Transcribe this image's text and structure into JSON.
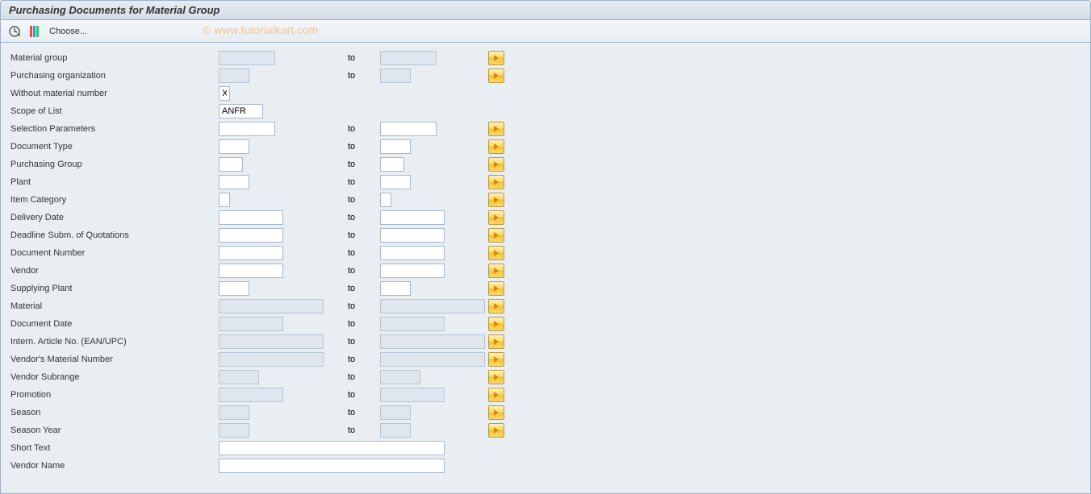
{
  "title": "Purchasing Documents for Material Group",
  "toolbar": {
    "choose_label": "Choose..."
  },
  "watermark": "© www.tutorialkart.com",
  "labels": {
    "to": "to"
  },
  "fields": {
    "material_group": {
      "label": "Material group",
      "from": "",
      "to": "",
      "has_range": true,
      "from_w": 70,
      "to_w": 70,
      "readonly": true
    },
    "purch_org": {
      "label": "Purchasing organization",
      "from": "",
      "to": "",
      "has_range": true,
      "from_w": 38,
      "to_w": 38,
      "readonly": true
    },
    "without_matnr": {
      "label": "Without material number",
      "from": "X",
      "has_range": false,
      "from_w": 14
    },
    "scope_list": {
      "label": "Scope of List",
      "from": "ANFR",
      "has_range": false,
      "from_w": 55
    },
    "sel_params": {
      "label": "Selection Parameters",
      "from": "",
      "to": "",
      "has_range": true,
      "from_w": 70,
      "to_w": 70
    },
    "doc_type": {
      "label": "Document Type",
      "from": "",
      "to": "",
      "has_range": true,
      "from_w": 38,
      "to_w": 38
    },
    "purch_group": {
      "label": "Purchasing Group",
      "from": "",
      "to": "",
      "has_range": true,
      "from_w": 30,
      "to_w": 30
    },
    "plant": {
      "label": "Plant",
      "from": "",
      "to": "",
      "has_range": true,
      "from_w": 38,
      "to_w": 38
    },
    "item_cat": {
      "label": "Item Category",
      "from": "",
      "to": "",
      "has_range": true,
      "from_w": 14,
      "to_w": 14
    },
    "deliv_date": {
      "label": "Delivery Date",
      "from": "",
      "to": "",
      "has_range": true,
      "from_w": 80,
      "to_w": 80
    },
    "deadline": {
      "label": "Deadline Subm. of Quotations",
      "from": "",
      "to": "",
      "has_range": true,
      "from_w": 80,
      "to_w": 80
    },
    "doc_number": {
      "label": "Document Number",
      "from": "",
      "to": "",
      "has_range": true,
      "from_w": 80,
      "to_w": 80
    },
    "vendor": {
      "label": "Vendor",
      "from": "",
      "to": "",
      "has_range": true,
      "from_w": 80,
      "to_w": 80
    },
    "supp_plant": {
      "label": "Supplying Plant",
      "from": "",
      "to": "",
      "has_range": true,
      "from_w": 38,
      "to_w": 38
    },
    "material": {
      "label": "Material",
      "from": "",
      "to": "",
      "has_range": true,
      "from_w": 130,
      "to_w": 130,
      "readonly": true
    },
    "doc_date": {
      "label": "Document Date",
      "from": "",
      "to": "",
      "has_range": true,
      "from_w": 80,
      "to_w": 80,
      "readonly": true
    },
    "ean": {
      "label": "Intern. Article No. (EAN/UPC)",
      "from": "",
      "to": "",
      "has_range": true,
      "from_w": 130,
      "to_w": 130,
      "readonly": true
    },
    "vend_matnr": {
      "label": "Vendor's Material Number",
      "from": "",
      "to": "",
      "has_range": true,
      "from_w": 130,
      "to_w": 130,
      "readonly": true
    },
    "vend_subrange": {
      "label": "Vendor Subrange",
      "from": "",
      "to": "",
      "has_range": true,
      "from_w": 50,
      "to_w": 50,
      "readonly": true
    },
    "promotion": {
      "label": "Promotion",
      "from": "",
      "to": "",
      "has_range": true,
      "from_w": 80,
      "to_w": 80,
      "readonly": true
    },
    "season": {
      "label": "Season",
      "from": "",
      "to": "",
      "has_range": true,
      "from_w": 38,
      "to_w": 38,
      "readonly": true
    },
    "season_year": {
      "label": "Season Year",
      "from": "",
      "to": "",
      "has_range": true,
      "from_w": 38,
      "to_w": 38,
      "readonly": true
    },
    "short_text": {
      "label": "Short Text",
      "from": "",
      "has_range": false,
      "from_w": 280
    },
    "vendor_name": {
      "label": "Vendor Name",
      "from": "",
      "has_range": false,
      "from_w": 280
    }
  },
  "field_order": [
    "material_group",
    "purch_org",
    "without_matnr",
    "scope_list",
    "sel_params",
    "doc_type",
    "purch_group",
    "plant",
    "item_cat",
    "deliv_date",
    "deadline",
    "doc_number",
    "vendor",
    "supp_plant",
    "material",
    "doc_date",
    "ean",
    "vend_matnr",
    "vend_subrange",
    "promotion",
    "season",
    "season_year",
    "short_text",
    "vendor_name"
  ]
}
